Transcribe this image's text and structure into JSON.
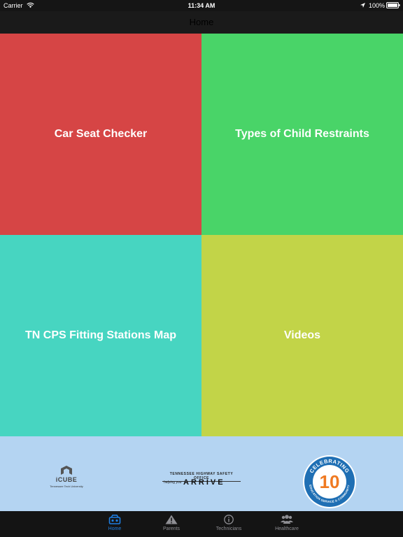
{
  "status": {
    "carrier": "Carrier",
    "time": "11:34 AM",
    "battery": "100%"
  },
  "nav": {
    "title": "Home"
  },
  "tiles": [
    {
      "label": "Car Seat Checker",
      "color": "#d64545"
    },
    {
      "label": "Types of Child Restraints",
      "color": "#49d468"
    },
    {
      "label": "TN CPS Fitting Stations Map",
      "color": "#47d5c1"
    },
    {
      "label": "Videos",
      "color": "#c2d448"
    }
  ],
  "banner": {
    "icube_name": "iCUBE",
    "icube_university": "Tennessee Tech University",
    "thso_office": "TENNESSEE HIGHWAY SAFETY OFFICE",
    "thso_helping": "helping you",
    "thso_arrive": "ARRIVE",
    "seal_text_top": "CELEBRATING",
    "seal_years": "10",
    "seal_text_bottom": "EDUCATION SERVICE & COMMUNITY"
  },
  "tabs": [
    {
      "label": "Home",
      "icon": "car-seat-icon",
      "active": true
    },
    {
      "label": "Parents",
      "icon": "warning-icon",
      "active": false
    },
    {
      "label": "Technicians",
      "icon": "info-icon",
      "active": false
    },
    {
      "label": "Healthcare",
      "icon": "people-icon",
      "active": false
    }
  ],
  "colors": {
    "accent": "#1e7de0",
    "banner_bg": "#b4d4f2",
    "tab_inactive": "#8e8e93"
  }
}
